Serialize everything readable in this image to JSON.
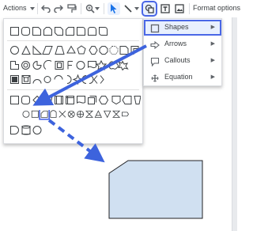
{
  "toolbar": {
    "actions_label": "Actions",
    "format_options_label": "Format options"
  },
  "shapes_menu": {
    "items": [
      {
        "label": "Shapes",
        "icon": "square-icon",
        "has_submenu": true,
        "active": true
      },
      {
        "label": "Arrows",
        "icon": "arrow-icon",
        "has_submenu": true,
        "active": false
      },
      {
        "label": "Callouts",
        "icon": "callout-icon",
        "has_submenu": true,
        "active": false
      },
      {
        "label": "Equation",
        "icon": "plus-icon",
        "has_submenu": true,
        "active": false
      }
    ]
  },
  "colors": {
    "highlight": "#4a67e6",
    "arrow": "#3d63dd",
    "shape_fill": "#d0e0f1",
    "shape_stroke": "#202124"
  }
}
